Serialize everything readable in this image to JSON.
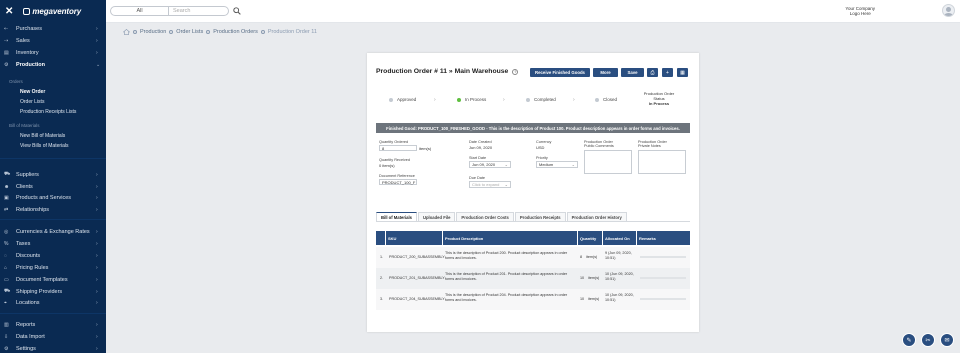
{
  "brand": {
    "logo_text": "megaventory"
  },
  "search": {
    "scope": "All",
    "placeholder": "Search"
  },
  "company_logo": {
    "line1": "Your Company",
    "line2": "Logo Here"
  },
  "sidebar": {
    "items": [
      {
        "label": "Purchases"
      },
      {
        "label": "Sales"
      },
      {
        "label": "Inventory"
      },
      {
        "label": "Production"
      },
      {
        "label": "Suppliers"
      },
      {
        "label": "Clients"
      },
      {
        "label": "Products and Services"
      },
      {
        "label": "Relationships"
      },
      {
        "label": "Currencies & Exchange Rates"
      },
      {
        "label": "Taxes"
      },
      {
        "label": "Discounts"
      },
      {
        "label": "Pricing Rules"
      },
      {
        "label": "Document Templates"
      },
      {
        "label": "Shipping Providers"
      },
      {
        "label": "Locations"
      },
      {
        "label": "Reports"
      },
      {
        "label": "Data Import"
      },
      {
        "label": "Settings"
      }
    ],
    "orders_section": "Orders",
    "orders_links": [
      "New Order",
      "Order Lists",
      "Production Receipts Lists"
    ],
    "bom_section": "Bill of Materials",
    "bom_links": [
      "New Bill of Materials",
      "View Bills of Materials"
    ]
  },
  "breadcrumb": [
    "Production",
    "Order Lists",
    "Production Orders",
    "Production Order 11"
  ],
  "order": {
    "title": "Production Order # 11 » Main Warehouse",
    "buttons": {
      "receive": "Receive Finished Goods",
      "more": "More",
      "save": "Save"
    },
    "steps": [
      "Approved",
      "In Process",
      "Completed",
      "Closed"
    ],
    "status_label": "Production Order Status",
    "status_value": "In Process",
    "banner": "Finished Good: PRODUCT_100_FINISHED_GOOD - This is the description of Product 100. Product description appears in order forms and invoices.",
    "fields": {
      "qty_ordered_label": "Quantity Ordered",
      "qty_ordered_value": "8",
      "qty_ordered_unit": "item(s)",
      "qty_received_label": "Quantity Received",
      "qty_received_value": "0 item(s)",
      "doc_ref_label": "Document Reference",
      "doc_ref_value": "PRODUCT_100_F",
      "date_created_label": "Date Created",
      "date_created_value": "Jun 09, 2020",
      "start_date_label": "Start Date",
      "start_date_value": "Jun 09, 2020",
      "due_date_label": "Due Date",
      "due_date_placeholder": "Click to expand",
      "currency_label": "Currency",
      "currency_value": "USD",
      "priority_label": "Priority",
      "priority_value": "Medium",
      "public_comments_label": "Production Order Public Comments",
      "private_notes_label": "Production Order Private Notes"
    },
    "tabs": [
      "Bill of Materials",
      "Uploaded File",
      "Production Order Costs",
      "Production Receipts",
      "Production Order History"
    ],
    "table": {
      "headers": [
        "SKU",
        "Product Description",
        "Quantity",
        "Allocated On",
        "Remarks"
      ],
      "rows": [
        {
          "num": "1.",
          "sku": "PRODUCT_200_SUBASSEMBLY",
          "desc": "This is the description of Product 200. Product description appears in order forms and invoices.",
          "qty": "8",
          "unit": "item(s)",
          "alloc": "9 (Jun 09, 2020, 10:51)"
        },
        {
          "num": "2.",
          "sku": "PRODUCT_201_SUBASSEMBLY",
          "desc": "This is the description of Product 201. Product description appears in order forms and invoices.",
          "qty": "10",
          "unit": "item(s)",
          "alloc": "10 (Jun 09, 2020, 10:51)"
        },
        {
          "num": "3.",
          "sku": "PRODUCT_204_SUBASSEMBLY",
          "desc": "This is the description of Product 204. Product description appears in order forms and invoices.",
          "qty": "10",
          "unit": "item(s)",
          "alloc": "10 (Jun 09, 2020, 10:51)"
        }
      ]
    }
  }
}
